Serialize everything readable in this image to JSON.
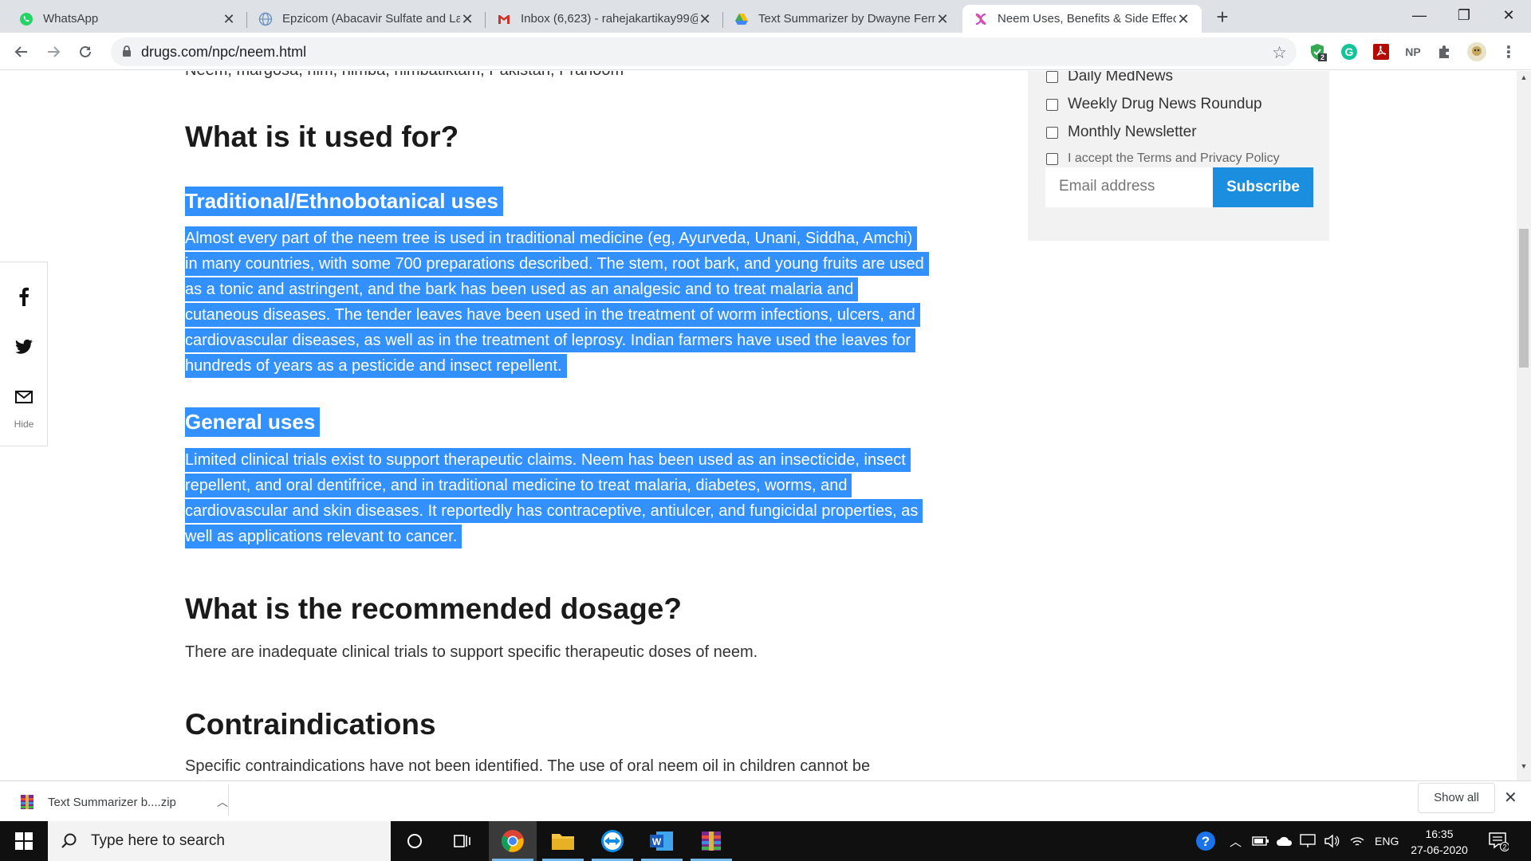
{
  "browser": {
    "tabs": [
      {
        "title": "WhatsApp",
        "icon": "whatsapp-icon"
      },
      {
        "title": "Epzicom (Abacavir Sulfate and La",
        "icon": "globe-icon"
      },
      {
        "title": "Inbox (6,623) - rahejakartikay99@",
        "icon": "gmail-icon"
      },
      {
        "title": "Text Summarizer by Dwayne Ferm",
        "icon": "google-drive-icon"
      },
      {
        "title": "Neem Uses, Benefits & Side Effec",
        "icon": "drugs-com-icon"
      }
    ],
    "new_tab": "+",
    "url": "drugs.com/npc/neem.html",
    "extension_badge": "2",
    "np_extension": "NP"
  },
  "article": {
    "cut_line": "Neem, margosa, nim, nimba, nimbatiktam, Pakistan, Pranoom",
    "heading_used_for": "What is it used for?",
    "sub_traditional": "Traditional/Ethnobotanical uses",
    "traditional_lines": [
      "Almost every part of the neem tree is used in traditional medicine (eg, Ayurveda, Unani, Siddha, Amchi)",
      "in many countries, with some 700 preparations described. The stem, root bark, and young fruits are used",
      "as a tonic and astringent, and the bark has been used as an analgesic and to treat malaria and",
      "cutaneous diseases. The tender leaves have been used in the treatment of worm infections, ulcers, and",
      "cardiovascular diseases, as well as in the treatment of leprosy. Indian farmers have used the leaves for",
      "hundreds of years as a pesticide and insect repellent."
    ],
    "sub_general": "General uses",
    "general_lines": [
      "Limited clinical trials exist to support therapeutic claims. Neem has been used as an insecticide, insect",
      "repellent, and oral dentifrice, and in traditional medicine to treat malaria, diabetes, worms, and",
      "cardiovascular and skin diseases. It reportedly has contraceptive, antiulcer, and fungicidal properties, as",
      "well as applications relevant to cancer."
    ],
    "heading_dosage": "What is the recommended dosage?",
    "dosage_text": "There are inadequate clinical trials to support specific therapeutic doses of neem.",
    "heading_contra": "Contraindications",
    "contra_text": "Specific contraindications have not been identified. The use of oral neem oil in children cannot be"
  },
  "share": {
    "hide_label": "Hide"
  },
  "newsletter": {
    "options": [
      "Daily MedNews",
      "Weekly Drug News Roundup",
      "Monthly Newsletter"
    ],
    "terms": "I accept the Terms and Privacy Policy",
    "email_placeholder": "Email address",
    "subscribe_label": "Subscribe"
  },
  "downloads": {
    "file": "Text Summarizer b....zip",
    "show_all": "Show all"
  },
  "taskbar": {
    "search_placeholder": "Type here to search",
    "language": "ENG",
    "time": "16:35",
    "date": "27-06-2020",
    "notification_count": "2"
  },
  "colors": {
    "selection": "#3390ff",
    "subscribe": "#1b8ee0",
    "tabstrip": "#dee1e6"
  }
}
